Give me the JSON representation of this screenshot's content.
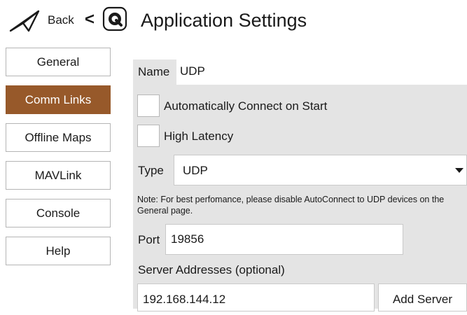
{
  "header": {
    "back_label": "Back",
    "chevron": "<",
    "title": "Application Settings",
    "back_icon": "paper-plane-icon",
    "app_icon": "qgc-logo-icon"
  },
  "sidebar": {
    "items": [
      {
        "label": "General",
        "active": false
      },
      {
        "label": "Comm Links",
        "active": true
      },
      {
        "label": "Offline Maps",
        "active": false
      },
      {
        "label": "MAVLink",
        "active": false
      },
      {
        "label": "Console",
        "active": false
      },
      {
        "label": "Help",
        "active": false
      }
    ]
  },
  "form": {
    "name_label": "Name",
    "name_value": "UDP",
    "auto_connect_label": "Automatically Connect on Start",
    "auto_connect_checked": false,
    "high_latency_label": "High Latency",
    "high_latency_checked": false,
    "type_label": "Type",
    "type_value": "UDP",
    "note": "Note: For best perfomance, please disable AutoConnect to UDP devices on the General page.",
    "port_label": "Port",
    "port_value": "19856",
    "server_addresses_label": "Server Addresses (optional)",
    "server_address_value": "192.168.144.12",
    "add_server_label": "Add Server"
  },
  "colors": {
    "active_accent": "#97592a",
    "panel_bg": "#e4e4e4"
  }
}
